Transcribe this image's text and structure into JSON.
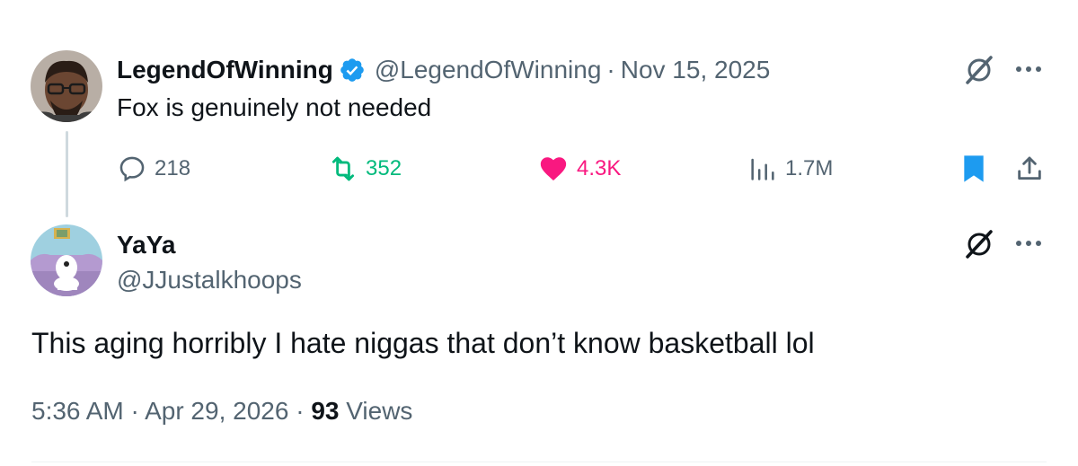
{
  "parent_tweet": {
    "display_name": "LegendOfWinning",
    "verified": true,
    "handle": "@LegendOfWinning",
    "separator": "·",
    "date": "Nov 15, 2025",
    "text": "Fox is genuinely not needed",
    "replies": "218",
    "reposts": "352",
    "likes": "4.3K",
    "views": "1.7M",
    "icons": [
      "grok-icon",
      "more-icon",
      "reply-icon",
      "repost-icon",
      "like-icon",
      "views-icon",
      "bookmark-icon",
      "share-icon"
    ]
  },
  "reply_tweet": {
    "display_name": "YaYa",
    "handle": "@JJustalkhoops",
    "text": "This aging horribly I hate niggas that don’t know basketball lol",
    "time": "5:36 AM",
    "separator": "·",
    "date": "Apr 29, 2026",
    "views_count": "93",
    "views_label": "Views",
    "icons": [
      "grok-icon",
      "more-icon"
    ]
  },
  "colors": {
    "text": "#0f1419",
    "muted": "#536471",
    "repost": "#00ba7c",
    "like": "#f91880",
    "bookmark": "#1d9bf0",
    "verified": "#1d9bf0"
  }
}
